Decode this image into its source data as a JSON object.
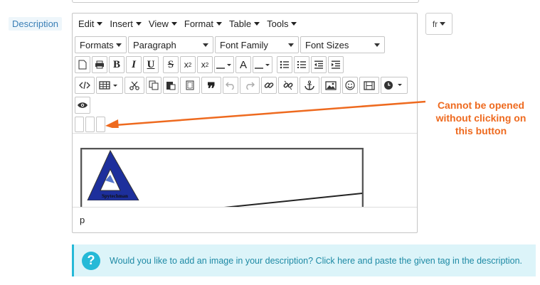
{
  "field": {
    "label": "Description"
  },
  "language": {
    "selected": "fr"
  },
  "menubar": [
    {
      "label": "Edit"
    },
    {
      "label": "Insert"
    },
    {
      "label": "View"
    },
    {
      "label": "Format"
    },
    {
      "label": "Table"
    },
    {
      "label": "Tools"
    }
  ],
  "toolbar": {
    "formats": "Formats",
    "block": "Paragraph",
    "font_family": "Font Family",
    "font_sizes": "Font Sizes",
    "bold": "B",
    "italic": "I",
    "underline": "U",
    "strike": "S",
    "superscript_base": "x",
    "superscript_mark": "2",
    "subscript_base": "x",
    "subscript_mark": "2",
    "text_color_letter": "A",
    "blockquote": "❞"
  },
  "status": {
    "path": "p"
  },
  "annotation": {
    "lines": [
      "Cannot be opened",
      "without clicking on",
      "this button"
    ],
    "color": "#ee6a1f"
  },
  "image_caption": "Spytechman",
  "info": {
    "text_before": "Would you like to add an image in your description?",
    "link": "Click here",
    "text_after": "and paste the given tag in the description.",
    "icon": "?"
  },
  "colors": {
    "accent": "#25b9d7",
    "label_blue": "#3a7fb6"
  }
}
